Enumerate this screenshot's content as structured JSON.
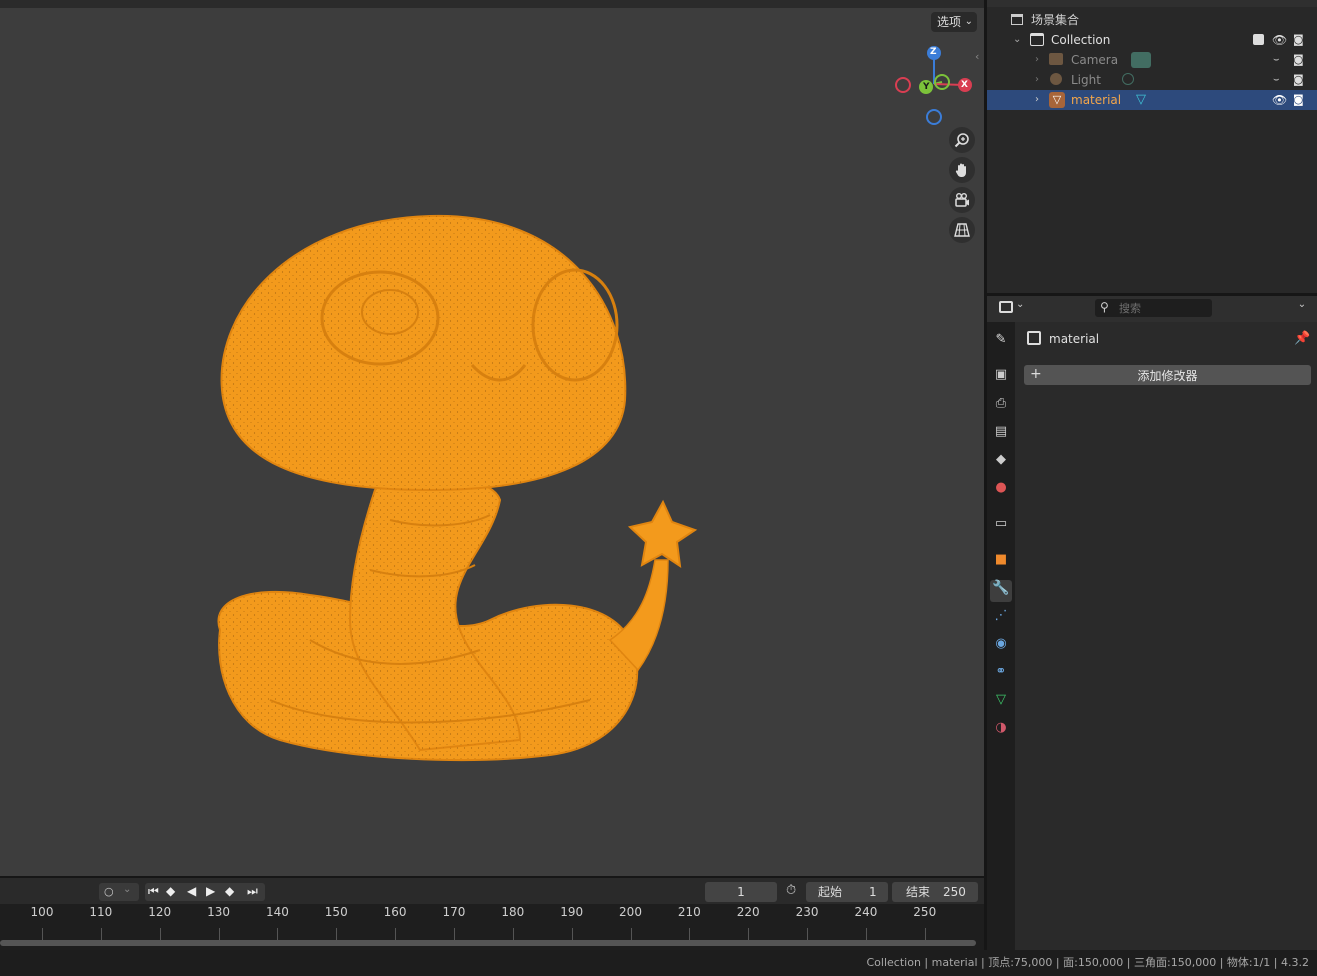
{
  "viewport": {
    "options_label": "选项",
    "gizmo": {
      "z": "Z",
      "y": "Y",
      "x": "X"
    }
  },
  "outliner": {
    "scene_collection": "场景集合",
    "items": [
      {
        "label": "Collection"
      },
      {
        "label": "Camera"
      },
      {
        "label": "Light"
      },
      {
        "label": "material"
      }
    ]
  },
  "properties": {
    "search_placeholder": "搜索",
    "object_name": "material",
    "add_modifier": "添加修改器"
  },
  "timeline": {
    "current_frame": "1",
    "start_label": "起始",
    "start_value": "1",
    "end_label": "结束",
    "end_value": "250",
    "ticks": [
      "100",
      "110",
      "120",
      "130",
      "140",
      "150",
      "160",
      "170",
      "180",
      "190",
      "200",
      "210",
      "220",
      "230",
      "240",
      "250"
    ]
  },
  "statusbar": {
    "text": "Collection | material | 顶点:75,000 | 面:150,000 | 三角面:150,000 | 物体:1/1 | 4.3.2"
  },
  "colors": {
    "viewport_bg": "#3d3d3d",
    "selection": "#2d4a7c",
    "model_orange": "#f39a1c",
    "accent_blue": "#4a8be0"
  }
}
